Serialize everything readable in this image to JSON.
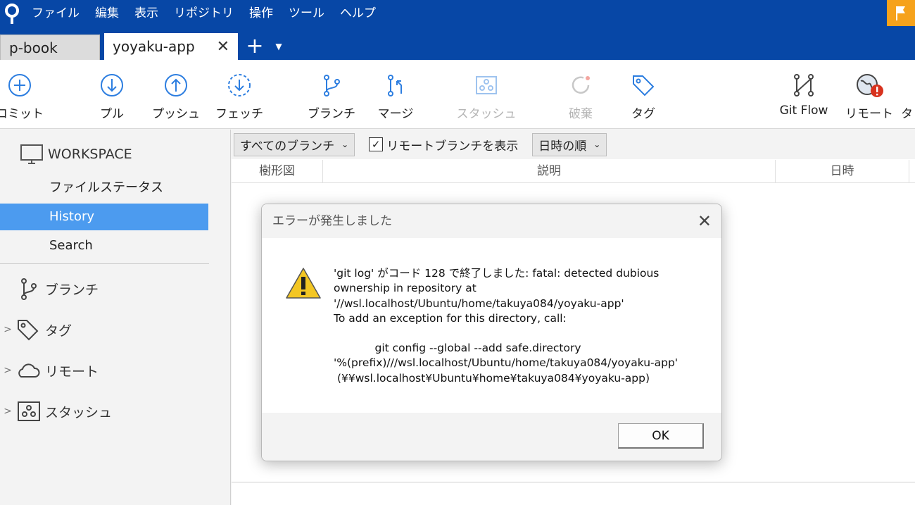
{
  "menu": [
    "ファイル",
    "編集",
    "表示",
    "リポジトリ",
    "操作",
    "ツール",
    "ヘルプ"
  ],
  "tabs": {
    "inactive": "p-book",
    "active": "yoyaku-app",
    "close": "✕",
    "add": "+",
    "dropdown": "▼"
  },
  "toolbar": {
    "commit": "コミット",
    "pull": "プル",
    "push": "プッシュ",
    "fetch": "フェッチ",
    "branch": "ブランチ",
    "merge": "マージ",
    "stash": "スタッシュ",
    "discard": "破棄",
    "tag": "タグ",
    "gitflow": "Git Flow",
    "remote": "リモート",
    "more": "タ"
  },
  "sidebar": {
    "workspace": "WORKSPACE",
    "items": [
      "ファイルステータス",
      "History",
      "Search"
    ],
    "groups": [
      "ブランチ",
      "タグ",
      "リモート",
      "スタッシュ"
    ]
  },
  "filters": {
    "branches": "すべてのブランチ",
    "show_remote": "リモートブランチを表示",
    "sort": "日時の順"
  },
  "columns": [
    "樹形図",
    "説明",
    "日時"
  ],
  "dialog": {
    "title": "エラーが発生しました",
    "message": "'git log' がコード 128 で終了しました: fatal: detected dubious ownership in repository at '//wsl.localhost/Ubuntu/home/takuya084/yoyaku-app'\nTo add an exception for this directory, call:",
    "command": "git config --global --add safe.directory",
    "path1": "'%(prefix)///wsl.localhost/Ubuntu/home/takuya084/yoyaku-app'",
    "path2": " (¥¥wsl.localhost¥Ubuntu¥home¥takuya084¥yoyaku-app)",
    "ok": "OK"
  },
  "colors": {
    "titlebar": "#0747a6",
    "accent": "#2d7ee0",
    "selected": "#4c9bef",
    "flag": "#f6a21b",
    "error_badge": "#d8321e"
  }
}
